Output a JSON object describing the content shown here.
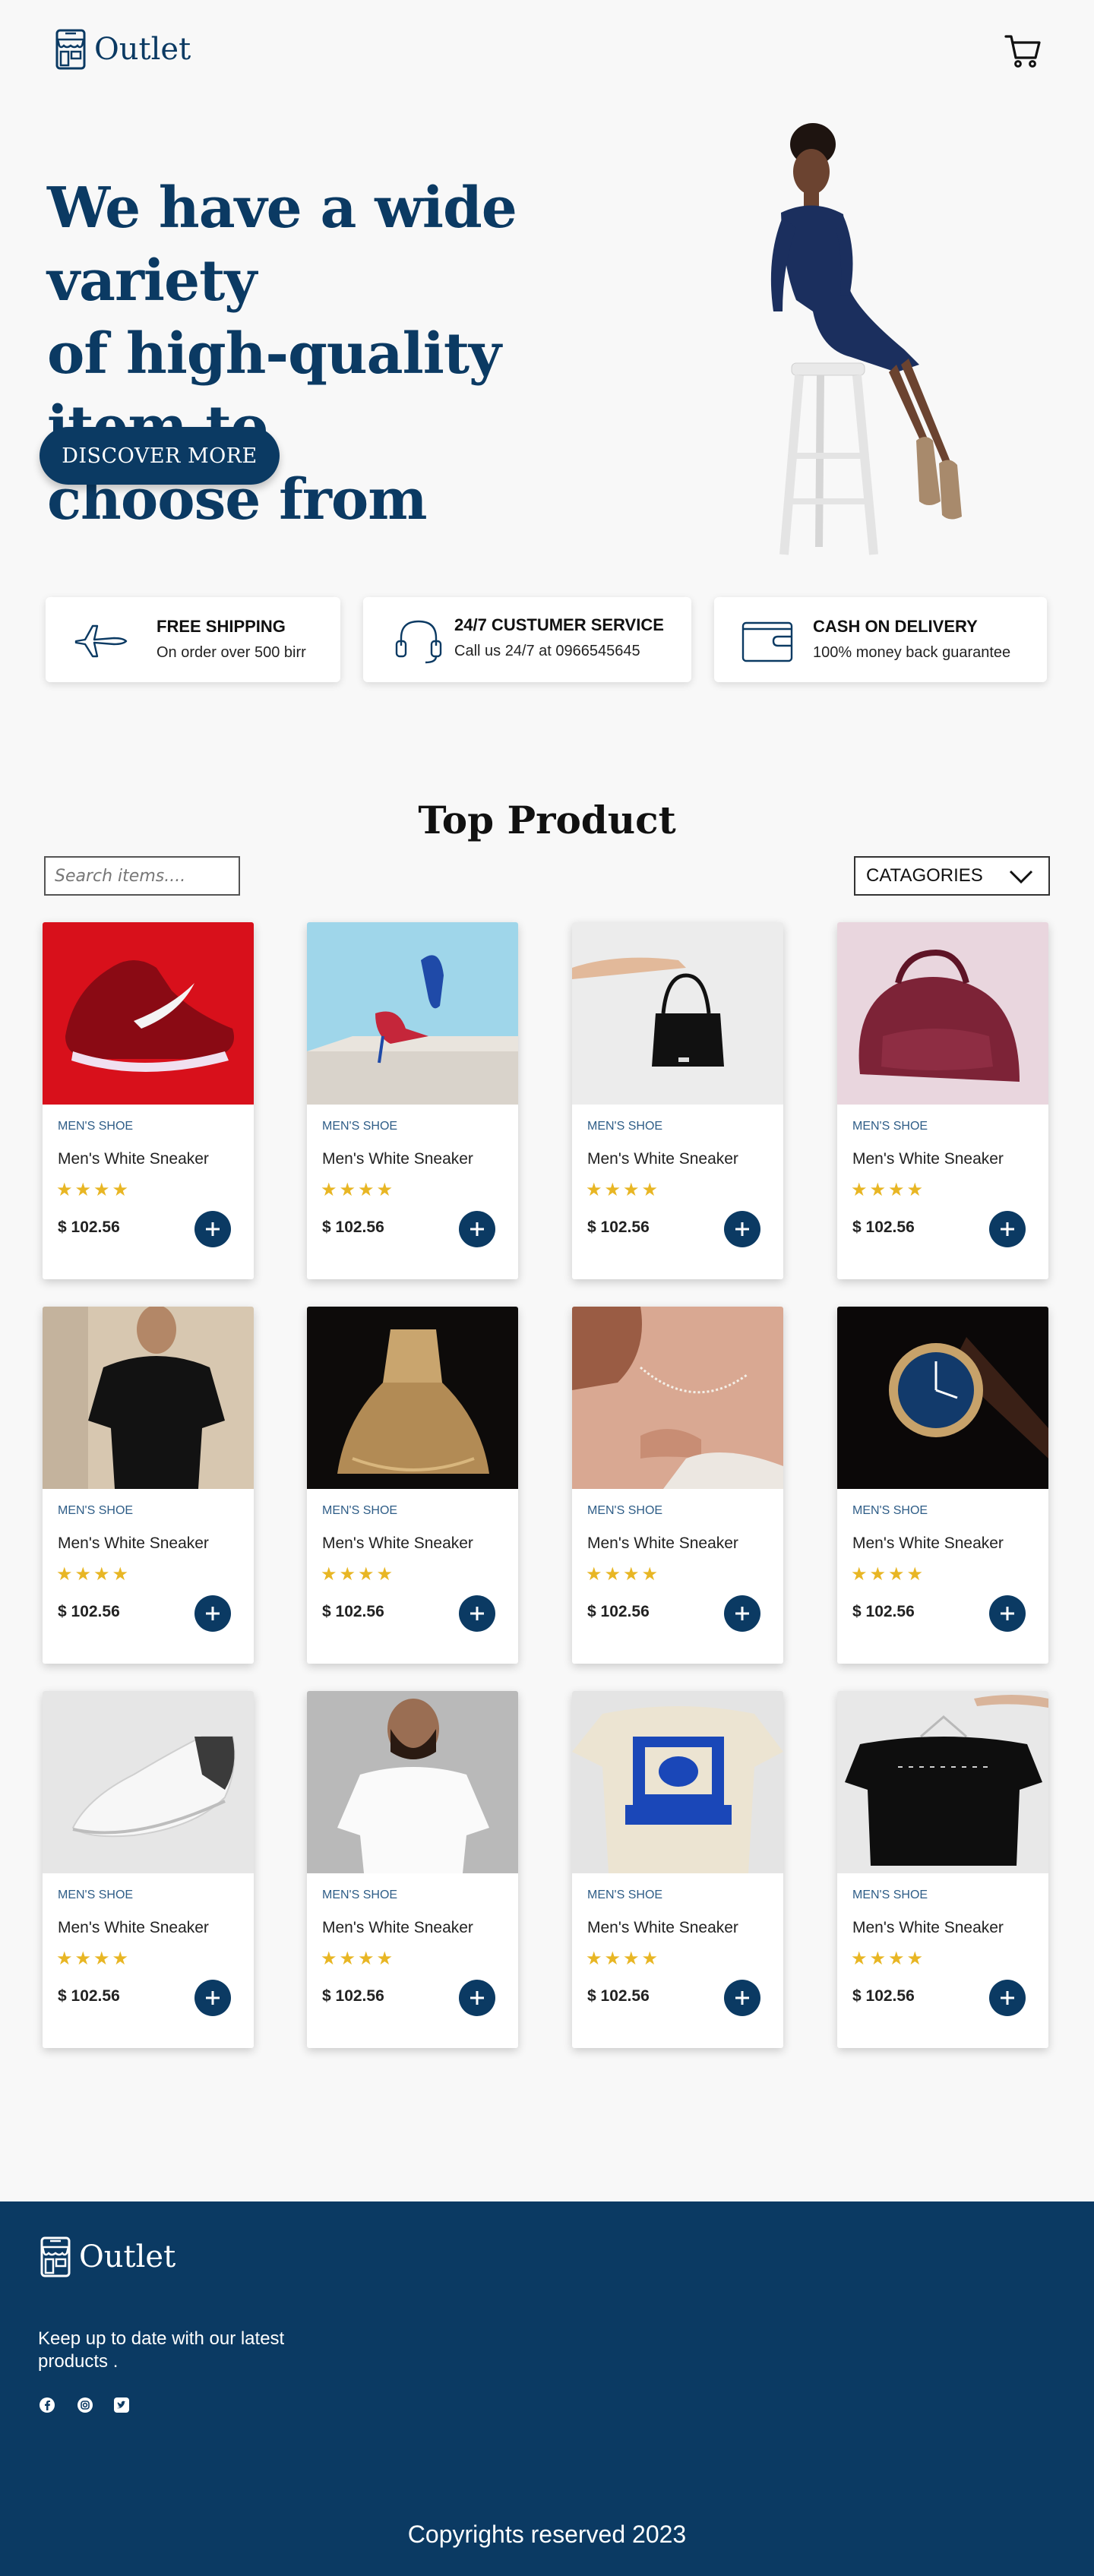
{
  "header": {
    "brand": "Outlet",
    "logo_icon": "storefront-icon",
    "cart_icon": "cart-icon"
  },
  "hero": {
    "title_line1": "We have a wide variety",
    "title_line2": "of high-quality item to",
    "title_line3": "choose from",
    "cta_label": "DISCOVER MORE"
  },
  "features": [
    {
      "icon": "airplane-icon",
      "title": "FREE SHIPPING",
      "subtitle": "On order over 500 birr"
    },
    {
      "icon": "headset-icon",
      "title": "24/7 CUSTUMER SERVICE",
      "subtitle": "Call us 24/7 at 0966545645"
    },
    {
      "icon": "wallet-icon",
      "title": "CASH ON DELIVERY",
      "subtitle": "100% money back guarantee"
    }
  ],
  "products_section": {
    "title": "Top Product",
    "search_placeholder": "Search items....",
    "categories_label": "CATAGORIES"
  },
  "products": [
    {
      "category": "MEN'S SHOE",
      "name": "Men's White Sneaker",
      "rating": 4,
      "price": "$ 102.56",
      "stars": "★★★★"
    },
    {
      "category": "MEN'S SHOE",
      "name": "Men's White Sneaker",
      "rating": 4,
      "price": "$ 102.56",
      "stars": "★★★★"
    },
    {
      "category": "MEN'S SHOE",
      "name": "Men's White Sneaker",
      "rating": 4,
      "price": "$ 102.56",
      "stars": "★★★★"
    },
    {
      "category": "MEN'S SHOE",
      "name": "Men's White Sneaker",
      "rating": 4,
      "price": "$ 102.56",
      "stars": "★★★★"
    },
    {
      "category": "MEN'S SHOE",
      "name": "Men's White Sneaker",
      "rating": 4,
      "price": "$ 102.56",
      "stars": "★★★★"
    },
    {
      "category": "MEN'S SHOE",
      "name": "Men's White Sneaker",
      "rating": 4,
      "price": "$ 102.56",
      "stars": "★★★★"
    },
    {
      "category": "MEN'S SHOE",
      "name": "Men's White Sneaker",
      "rating": 4,
      "price": "$ 102.56",
      "stars": "★★★★"
    },
    {
      "category": "MEN'S SHOE",
      "name": "Men's White Sneaker",
      "rating": 4,
      "price": "$ 102.56",
      "stars": "★★★★"
    },
    {
      "category": "MEN'S SHOE",
      "name": "Men's White Sneaker",
      "rating": 4,
      "price": "$ 102.56",
      "stars": "★★★★"
    },
    {
      "category": "MEN'S SHOE",
      "name": "Men's White Sneaker",
      "rating": 4,
      "price": "$ 102.56",
      "stars": "★★★★"
    },
    {
      "category": "MEN'S SHOE",
      "name": "Men's White Sneaker",
      "rating": 4,
      "price": "$ 102.56",
      "stars": "★★★★"
    },
    {
      "category": "MEN'S SHOE",
      "name": "Men's White Sneaker",
      "rating": 4,
      "price": "$ 102.56",
      "stars": "★★★★"
    }
  ],
  "footer": {
    "brand": "Outlet",
    "tagline": "Keep up to date with our latest products .",
    "social_icons": [
      "facebook-icon",
      "instagram-icon",
      "twitter-icon"
    ],
    "copyright": "Copyrights reserved 2023"
  },
  "colors": {
    "primary": "#0b3a63",
    "star": "#e8b624",
    "background": "#f8f8f8"
  }
}
